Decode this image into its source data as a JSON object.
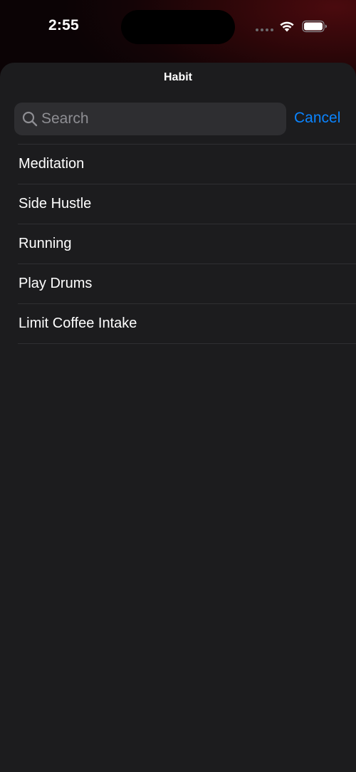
{
  "status_bar": {
    "time": "2:55"
  },
  "sheet": {
    "title": "Habit"
  },
  "search": {
    "placeholder": "Search",
    "value": "",
    "cancel_label": "Cancel"
  },
  "habits": [
    {
      "label": "Meditation"
    },
    {
      "label": "Side Hustle"
    },
    {
      "label": "Running"
    },
    {
      "label": "Play Drums"
    },
    {
      "label": "Limit Coffee Intake"
    }
  ],
  "colors": {
    "accent": "#0a84ff",
    "sheet_background": "#1c1c1e",
    "search_background": "#2e2e31"
  },
  "icons": {
    "search": "magnifying-glass",
    "wifi": "wifi",
    "battery": "battery-full",
    "signal": "cellular-signal-dots"
  }
}
